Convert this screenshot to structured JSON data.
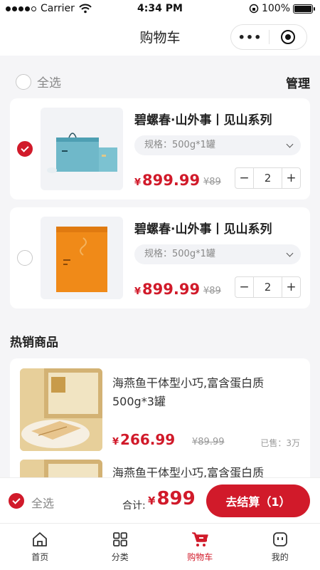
{
  "status_bar": {
    "carrier": "Carrier",
    "time": "4:34 PM",
    "battery": "100%"
  },
  "navbar": {
    "title": "购物车",
    "more_icon": "more-dots-icon",
    "close_icon": "target-icon"
  },
  "toolbar": {
    "select_all": "全选",
    "manage": "管理"
  },
  "cart_items": [
    {
      "title": "碧螺春·山外事丨见山系列",
      "spec": "规格：500g*1罐",
      "price_symbol": "¥",
      "price": "899.99",
      "old_price": "¥89",
      "quantity": "2",
      "selected": true
    },
    {
      "title": "碧螺春·山外事丨见山系列",
      "spec": "规格：500g*1罐",
      "price_symbol": "¥",
      "price": "899.99",
      "old_price": "¥89",
      "quantity": "2",
      "selected": false
    }
  ],
  "hot_section": {
    "title": "热销商品"
  },
  "hot_items": [
    {
      "title": "海燕鱼干体型小巧,富含蛋白质500g*3罐",
      "price_symbol": "¥",
      "price": "266.99",
      "old_price": "¥89.99",
      "sold": "已售：3万"
    },
    {
      "title": "海燕鱼干体型小巧,富含蛋白质"
    }
  ],
  "checkout": {
    "select_all": "全选",
    "total_label": "合计:",
    "price_symbol": "¥",
    "total": "899",
    "button": "去结算（1）"
  },
  "tabbar": [
    {
      "label": "首页",
      "icon": "home-icon",
      "active": false
    },
    {
      "label": "分类",
      "icon": "category-icon",
      "active": false
    },
    {
      "label": "购物车",
      "icon": "cart-icon",
      "active": true
    },
    {
      "label": "我的",
      "icon": "profile-icon",
      "active": false
    }
  ],
  "colors": {
    "accent": "#d11a2a",
    "background": "#f5f5f7"
  }
}
